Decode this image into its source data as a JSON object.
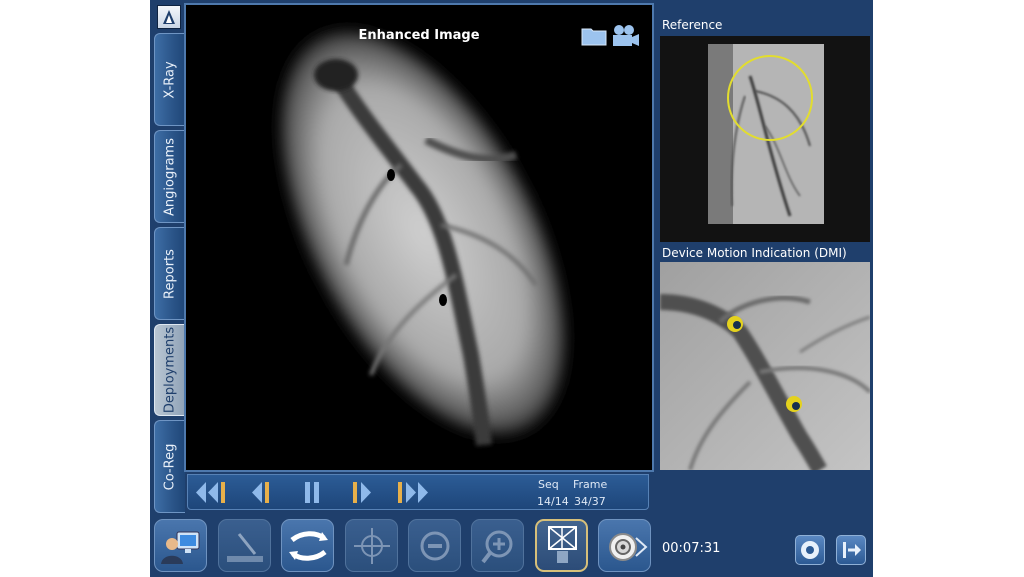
{
  "tabs": [
    {
      "label": "X-Ray",
      "active": false
    },
    {
      "label": "Angiograms",
      "active": false
    },
    {
      "label": "Reports",
      "active": false
    },
    {
      "label": "Deployments",
      "active": true
    },
    {
      "label": "Co-Reg",
      "active": false
    }
  ],
  "viewer": {
    "title": "Enhanced Image",
    "icons": [
      "folder-icon",
      "video-camera-icon"
    ]
  },
  "playback": {
    "buttons": [
      "first-sequence-icon",
      "previous-frame-icon",
      "pause-icon",
      "next-frame-icon",
      "last-sequence-icon"
    ],
    "seq_label": "Seq",
    "frame_label": "Frame",
    "seq_value": "14/14",
    "frame_value": "34/37"
  },
  "toolbar": {
    "buttons": [
      {
        "icon": "user-workstation-icon",
        "state": "enabled"
      },
      {
        "icon": "guidewire-icon",
        "state": "disabled"
      },
      {
        "icon": "swap-arrows-icon",
        "state": "enabled"
      },
      {
        "icon": "crosshair-icon",
        "state": "disabled"
      },
      {
        "icon": "zoom-out-icon",
        "state": "disabled"
      },
      {
        "icon": "zoom-in-icon",
        "state": "disabled"
      },
      {
        "icon": "stent-icon",
        "state": "selected"
      },
      {
        "icon": "camera-lens-icon",
        "state": "enabled"
      }
    ]
  },
  "reference": {
    "title": "Reference"
  },
  "dmi": {
    "title": "Device Motion Indication (DMI)"
  },
  "status": {
    "timer": "00:07:31"
  },
  "colors": {
    "background": "#1f3f6c",
    "accent_border": "#4e79ad",
    "marker": "#d9c62a"
  }
}
